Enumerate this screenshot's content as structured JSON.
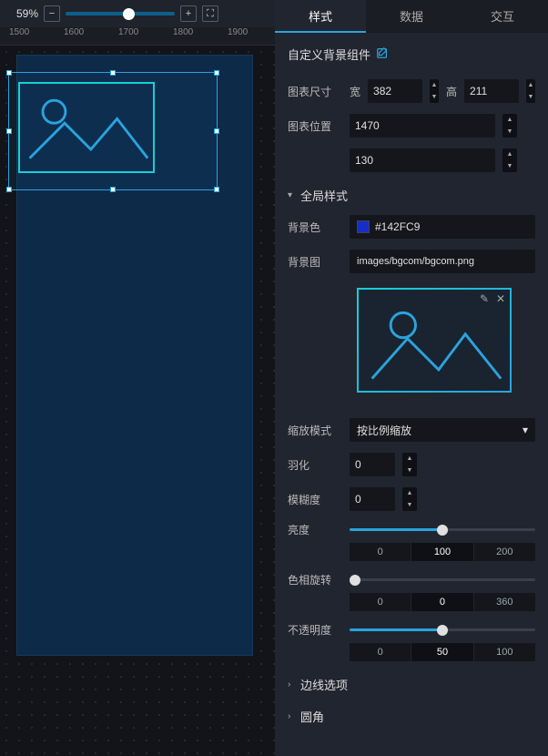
{
  "topbar": {
    "zoom_pct": "59%",
    "zoom_value": 59,
    "minus": "−",
    "plus": "+",
    "fit": "⛶"
  },
  "ruler": {
    "ticks": [
      "1500",
      "1600",
      "1700",
      "1800",
      "1900"
    ]
  },
  "tabs": {
    "style": "样式",
    "data": "数据",
    "interaction": "交互"
  },
  "header": {
    "title": "自定义背景组件",
    "edit_icon": "edit-icon"
  },
  "size": {
    "label": "图表尺寸",
    "w_label": "宽",
    "w": "382",
    "h_label": "高",
    "h": "211"
  },
  "pos": {
    "label": "图表位置",
    "x": "1470",
    "y": "130"
  },
  "sections": {
    "global": "全局样式",
    "border": "边线选项",
    "radius": "圆角"
  },
  "bgcolor": {
    "label": "背景色",
    "value": "#142FC9"
  },
  "bgimg": {
    "label": "背景图",
    "value": "images/bgcom/bgcom.png"
  },
  "scale": {
    "label": "缩放模式",
    "value": "按比例缩放"
  },
  "feather": {
    "label": "羽化",
    "value": "0"
  },
  "blur": {
    "label": "模糊度",
    "value": "0"
  },
  "brightness": {
    "label": "亮度",
    "value": 100,
    "min": "0",
    "mid": "100",
    "max": "200"
  },
  "hue": {
    "label": "色相旋转",
    "value": 0,
    "min": "0",
    "mid": "0",
    "max": "360"
  },
  "opacity": {
    "label": "不透明度",
    "value": 50,
    "min": "0",
    "mid": "50",
    "max": "100"
  },
  "icons": {
    "chev_down": "▾",
    "chev_right": "›",
    "caret": "▾",
    "pencil": "✎",
    "close": "✕",
    "up": "▲",
    "down": "▼"
  }
}
